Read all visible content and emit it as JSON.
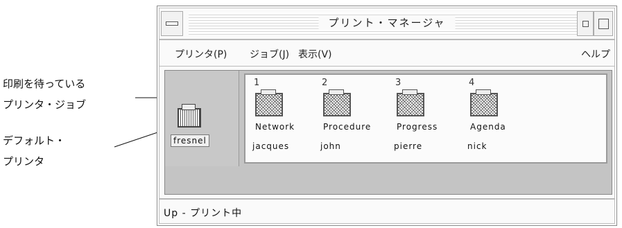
{
  "callouts": {
    "queue": {
      "line1": "印刷を待っている",
      "line2": "プリンタ・ジョブ"
    },
    "default_printer": {
      "line1": "デフォルト・",
      "line2": "プリンタ"
    }
  },
  "window": {
    "title": "プリント・マネージャ",
    "menu": {
      "printer": "プリンタ(P)",
      "job": "ジョブ(J)",
      "view": "表示(V)",
      "help": "ヘルプ"
    },
    "default_printer_name": "fresnel",
    "jobs": [
      {
        "number": "1",
        "file": "Network",
        "owner": "jacques"
      },
      {
        "number": "2",
        "file": "Procedure",
        "owner": "john"
      },
      {
        "number": "3",
        "file": "Progress",
        "owner": "pierre"
      },
      {
        "number": "4",
        "file": "Agenda",
        "owner": "nick"
      }
    ],
    "status": "Up - プリント中"
  }
}
